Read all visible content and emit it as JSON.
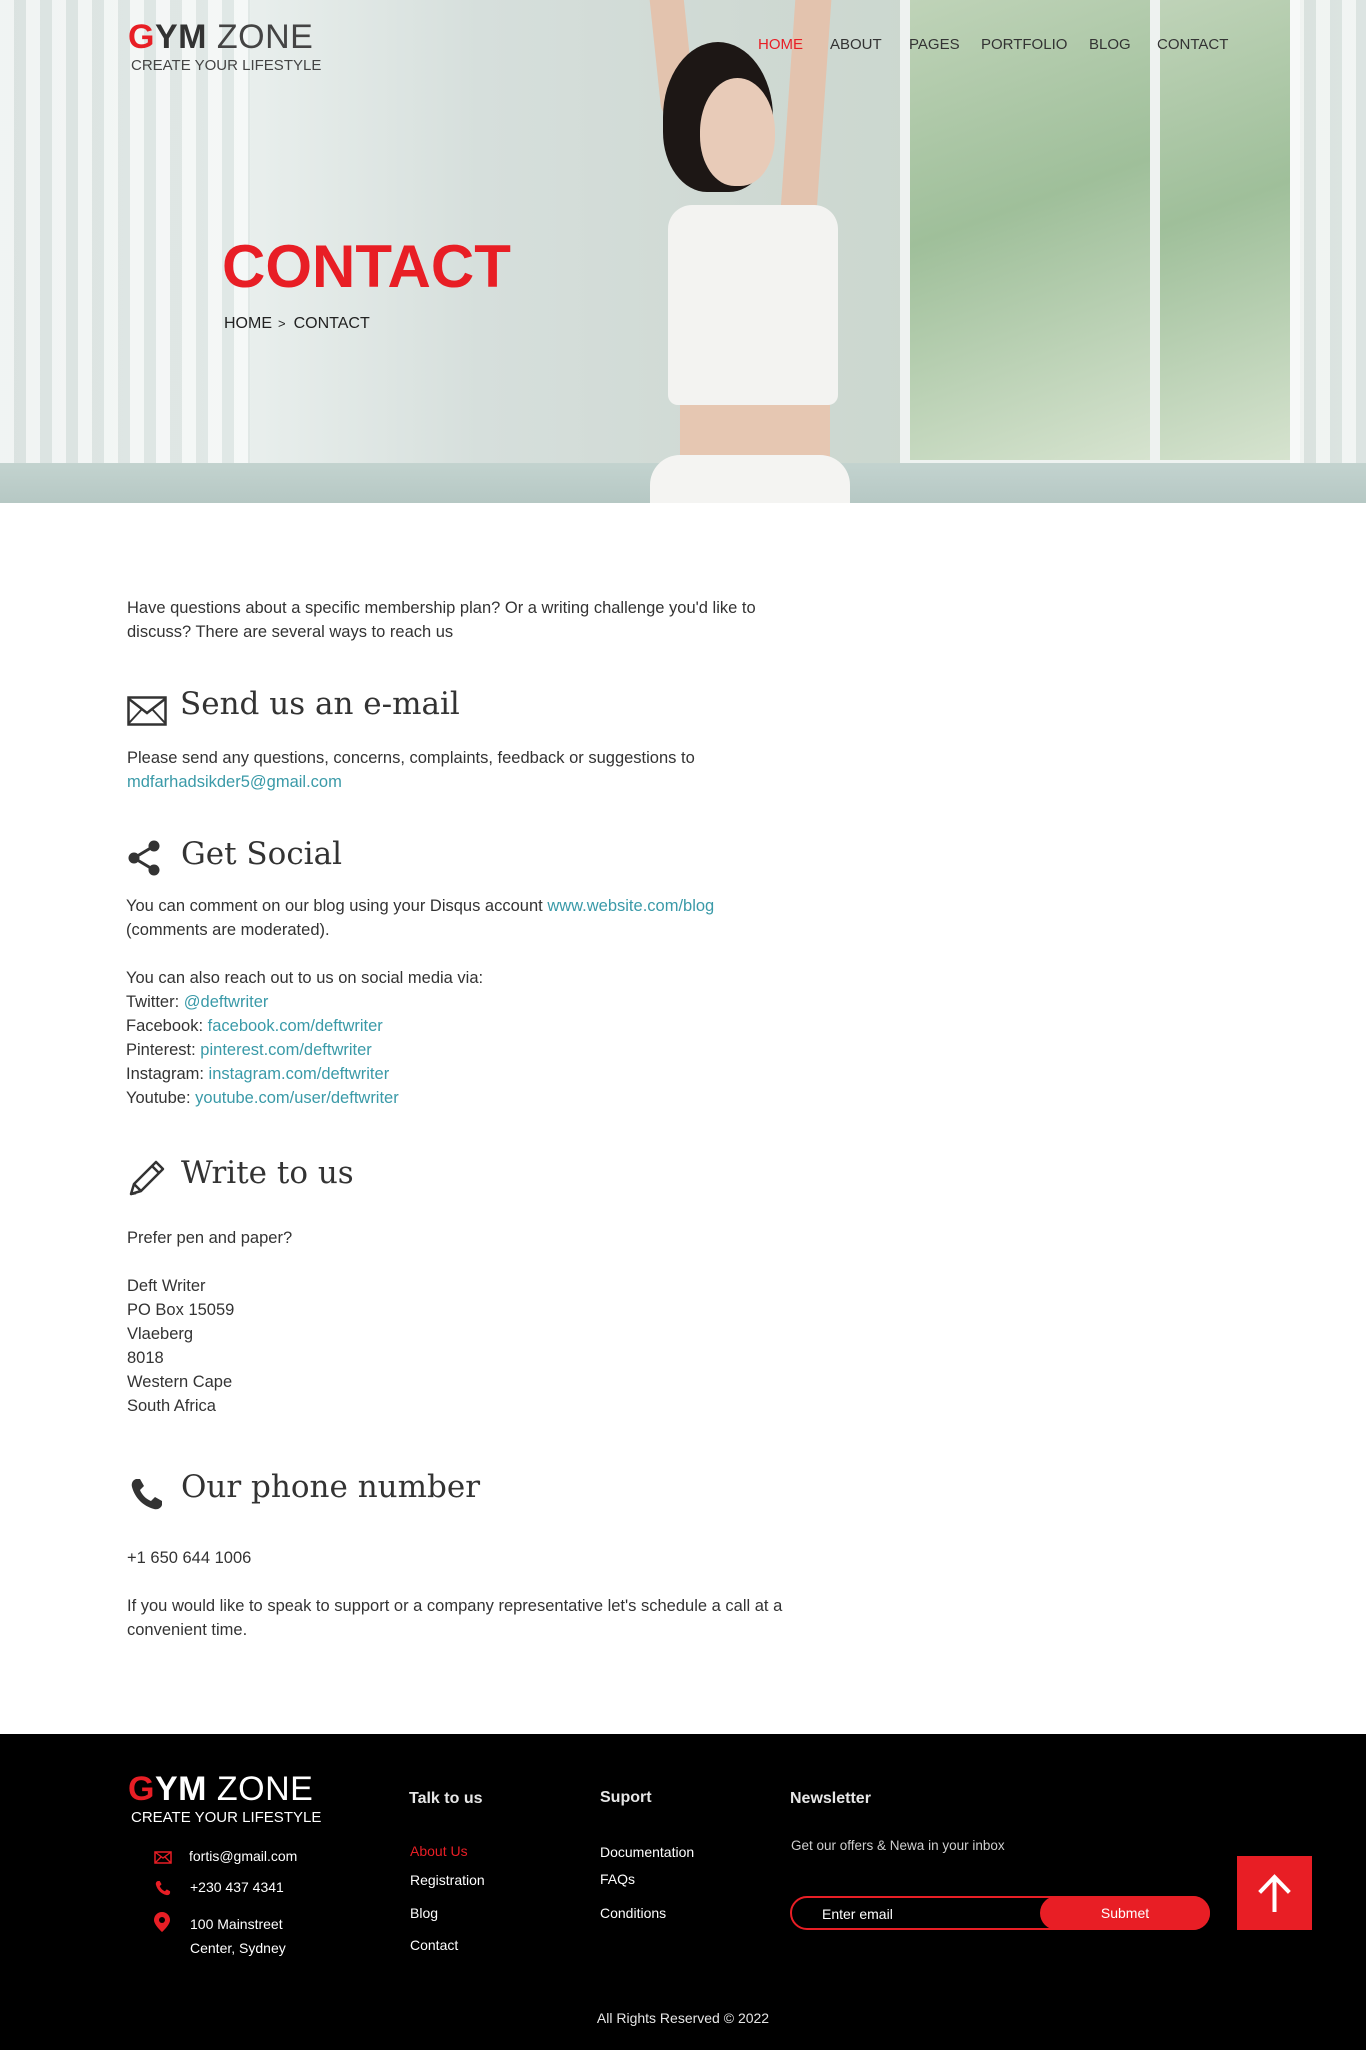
{
  "brand": {
    "letter_g": "G",
    "letters_ym": "YM",
    "word_zone": "ZONE",
    "tagline": "CREATE YOUR LIFESTYLE",
    "accent_color": "#e81e25"
  },
  "nav": {
    "items": [
      {
        "label": "HOME",
        "active": true
      },
      {
        "label": "ABOUT"
      },
      {
        "label": "PAGES"
      },
      {
        "label": "PORTFOLIO"
      },
      {
        "label": "BLOG"
      },
      {
        "label": "CONTACT"
      }
    ]
  },
  "hero": {
    "title": "CONTACT",
    "breadcrumb_home": "HOME",
    "breadcrumb_sep": ">",
    "breadcrumb_current": "CONTACT"
  },
  "intro": {
    "line1": "Have questions about a specific membership plan? Or a writing challenge you'd like to",
    "line2": "discuss? There are several ways to reach us"
  },
  "email_section": {
    "heading": "Send us an e-mail",
    "icon": "envelope-icon",
    "text": "Please send any questions, concerns, complaints, feedback or suggestions to",
    "email": "mdfarhadsikder5@gmail.com"
  },
  "social_section": {
    "heading": "Get Social",
    "icon": "share-icon",
    "text_before": "You can comment on our blog using your Disqus account",
    "blog_link": "www.website.com/blog",
    "text_after": "(comments are moderated).",
    "reach_text": "You can also reach out to us on social media via:",
    "channels": [
      {
        "label": "Twitter:",
        "link": "@deftwriter"
      },
      {
        "label": "Facebook:",
        "link": "facebook.com/deftwriter"
      },
      {
        "label": "Pinterest:",
        "link": "pinterest.com/deftwriter"
      },
      {
        "label": "Instagram:",
        "link": "instagram.com/deftwriter"
      },
      {
        "label": "Youtube:",
        "link": "youtube.com/user/deftwriter"
      }
    ]
  },
  "write_section": {
    "heading": "Write to us",
    "icon": "pencil-icon",
    "text": "Prefer pen and paper?",
    "address": [
      "Deft Writer",
      "PO Box 15059",
      "Vlaeberg",
      "8018",
      "Western Cape",
      "South Africa"
    ]
  },
  "phone_section": {
    "heading": "Our phone number",
    "icon": "phone-icon",
    "number": "+1 650 644 1006",
    "text_line1": "If you would like to speak to support or a company representative let's schedule a call at a",
    "text_line2": "convenient time."
  },
  "footer": {
    "contact": {
      "email": "fortis@gmail.com",
      "phone": "+230 437 4341",
      "address_line1": "100 Mainstreet",
      "address_line2": "Center, Sydney"
    },
    "talk": {
      "heading": "Talk to us",
      "links": [
        "About Us",
        "Registration",
        "Blog",
        "Contact"
      ]
    },
    "support": {
      "heading": "Suport",
      "links": [
        "Documentation",
        "FAQs",
        "Conditions"
      ]
    },
    "newsletter": {
      "heading": "Newsletter",
      "text": "Get our offers & Newa in your inbox",
      "placeholder": "Enter email",
      "button": "Submet"
    },
    "copyright": "All Rights Reserved © 2022"
  }
}
